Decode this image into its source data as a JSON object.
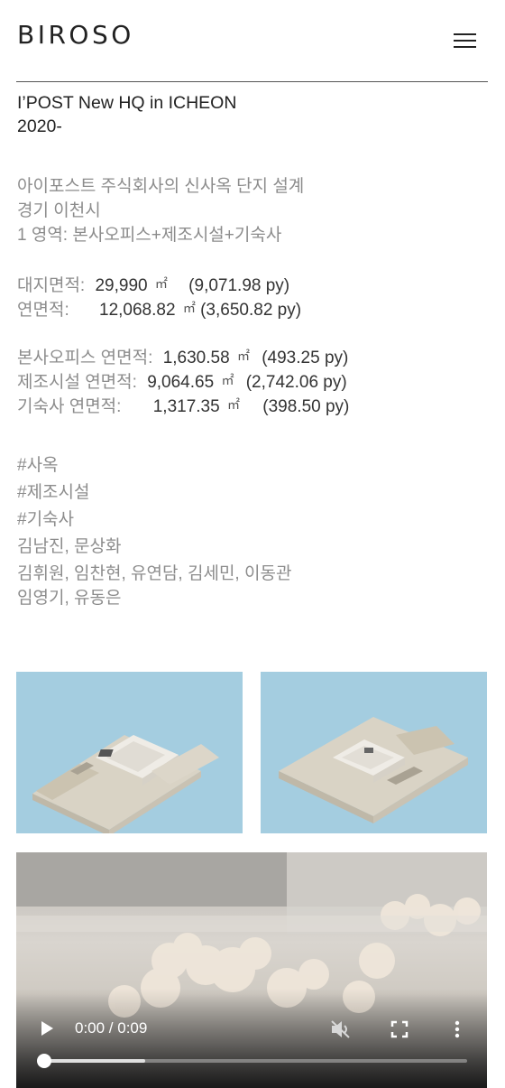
{
  "header": {
    "logo": "BIROSO",
    "menu_icon": "hamburger-menu-icon"
  },
  "project": {
    "title": "I’POST New HQ in ICHEON",
    "year": "2020-",
    "description": [
      "아이포스트 주식회사의 신사옥 단지 설계",
      "경기 이천시",
      "1 영역: 본사오피스+제조시설+기숙사"
    ]
  },
  "areas": {
    "site": {
      "label": "대지면적:",
      "value": "29,990",
      "unit": "㎡",
      "py": "(9,071.98 py)"
    },
    "gross": {
      "label": "연면적:",
      "value": "12,068.82",
      "unit": "㎡",
      "py": "(3,650.82 py)"
    },
    "office": {
      "label": "본사오피스 연면적:",
      "value": "1,630.58",
      "unit": "㎡",
      "py": "(493.25 py)"
    },
    "factory": {
      "label": "제조시설 연면적:",
      "value": "9,064.65",
      "unit": "㎡",
      "py": "(2,742.06 py)"
    },
    "dorm": {
      "label": "기숙사 연면적:",
      "value": "1,317.35",
      "unit": "㎡",
      "py": "(398.50 py)"
    }
  },
  "tags": [
    "#사옥",
    "#제조시설",
    "#기숙사"
  ],
  "credits": {
    "principals": "김남진, 문상화",
    "team_line1": "김휘원, 임찬현, 유연담, 김세민, 이동관",
    "team_line2": "임영기, 유동은"
  },
  "gallery": {
    "thumb_bg": "#a4cde0"
  },
  "video": {
    "time": "0:00 / 0:09",
    "progress": 0.0,
    "buffered": 0.24
  }
}
